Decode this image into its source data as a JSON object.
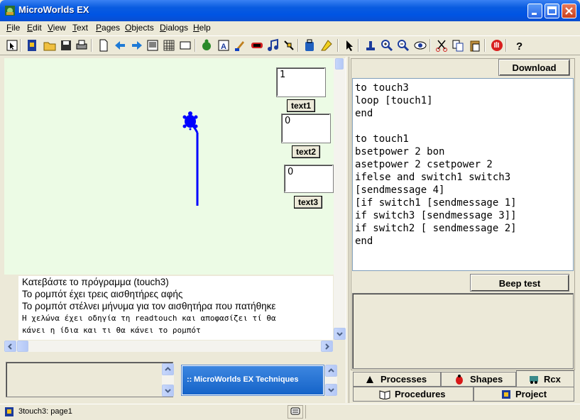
{
  "window": {
    "title": "MicroWorlds EX"
  },
  "menu": [
    {
      "label": "File",
      "u": "F",
      "rest": "ile"
    },
    {
      "label": "Edit",
      "u": "E",
      "rest": "dit"
    },
    {
      "label": "View",
      "u": "V",
      "rest": "iew"
    },
    {
      "label": "Text",
      "u": "T",
      "rest": "ext"
    },
    {
      "label": "Pages",
      "u": "P",
      "rest": "ages"
    },
    {
      "label": "Objects",
      "u": "O",
      "rest": "bjects"
    },
    {
      "label": "Dialogs",
      "u": "D",
      "rest": "ialogs"
    },
    {
      "label": "Help",
      "u": "H",
      "rest": "elp"
    }
  ],
  "toolbar_icons": [
    "pointer-small-icon",
    "project-icon",
    "open-folder-icon",
    "save-icon",
    "print-icon",
    "new-page-icon",
    "page-back-icon",
    "page-forward-icon",
    "present-icon",
    "grid-icon",
    "fullscreen-icon",
    "new-turtle-icon",
    "text-box-icon",
    "paint-icon",
    "button-tool-icon",
    "music-icon",
    "slider-icon",
    "backpack-icon",
    "hatch-icon",
    "select-arrow-icon",
    "stamp-icon",
    "zoom-in-icon",
    "zoom-out-icon",
    "eye-icon",
    "cut-icon",
    "copy-icon",
    "paste-icon",
    "stop-icon",
    "help-icon"
  ],
  "page": {
    "text_boxes": [
      {
        "value": "1",
        "label": "text1"
      },
      {
        "value": "0",
        "label": "text2"
      },
      {
        "value": "0",
        "label": "text3"
      }
    ]
  },
  "command_center": {
    "lines": [
      "Κατεβάστε το πρόγραμμα      (touch3)",
      "Το ρομπότ έχει  τρεις αισθητήρες αφής",
      "Το ρομπότ στέλνει μήνυμα για τον αισθητήρα που πατήθηκε",
      "Η χελώνα έχει οδηγία τη readtouch και αποφασίζει τί θα",
      "κάνει η ίδια και τι θα κάνει το ρομπότ"
    ]
  },
  "techniques": {
    "label": "MicroWorlds EX Techniques",
    "handle": "::"
  },
  "download_label": "Download",
  "code": "to touch3\nloop [touch1]\nend\n\nto touch1\nbsetpower 2 bon\nasetpower 2 csetpower 2\nifelse and switch1 switch3\n[sendmessage 4]\n[if switch1 [sendmessage 1]\nif switch3 [sendmessage 3]]\nif switch2 [ sendmessage 2]\nend",
  "beep_label": "Beep test",
  "tabs": {
    "processes": "Processes",
    "shapes": "Shapes",
    "rcx": "Rcx",
    "procedures": "Procedures",
    "project": "Project"
  },
  "status": {
    "text": "3touch3:  page1"
  },
  "colors": {
    "titlebar": "#0054e3",
    "page_bg": "#ecfbe5",
    "turtle": "#0000ff",
    "chrome": "#ece9d8"
  }
}
